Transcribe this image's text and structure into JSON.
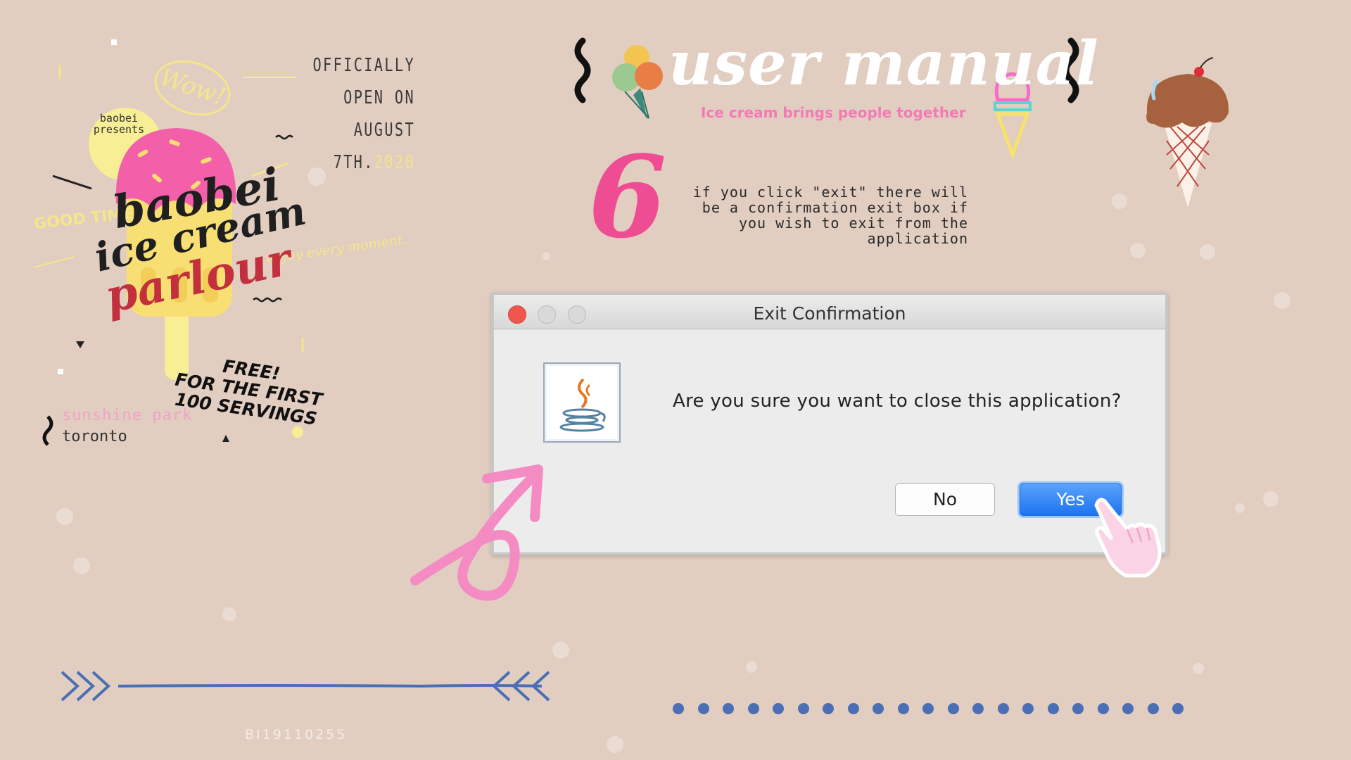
{
  "poster": {
    "open_line1": "OFFICIALLY OPEN ON",
    "open_line2": "AUGUST 7TH.",
    "open_year": "2020",
    "presents": "baobei presents",
    "wow": "Wow!",
    "good_times": "GOOD TIMES",
    "enjoy": "enjoy every moment.",
    "brand_line1": "baobei",
    "brand_line2": "ice cream",
    "brand_line3": "parlour",
    "free_line1": "FREE!",
    "free_line2": "FOR THE FIRST",
    "free_line3": "100 SERVINGS",
    "location": "sunshine park",
    "city": "toronto",
    "code": "BI19110255"
  },
  "header": {
    "title": "user manual",
    "tagline": "Ice cream brings people together"
  },
  "step": {
    "number": "6",
    "description": "if you click \"exit\" there will be a confirmation exit box if you wish to exit from the application"
  },
  "dialog": {
    "title": "Exit Confirmation",
    "message": "Are you sure you want to close this application?",
    "no_label": "No",
    "yes_label": "Yes"
  },
  "colors": {
    "background": "#e2cdc1",
    "accent_pink": "#f47ab7",
    "yes_button": "#1d73f1",
    "decor_blue": "#4a6fb5"
  },
  "icons": [
    "java-icon",
    "ice-cream-cone-icon",
    "pointer-hand-icon",
    "curved-arrow-icon",
    "popsicle-icon"
  ]
}
